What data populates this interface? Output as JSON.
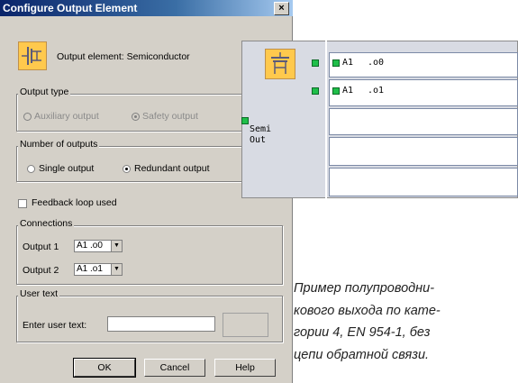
{
  "dialog": {
    "title": "Configure Output Element",
    "close_glyph": "×",
    "element_label": "Output element: Semiconductor",
    "output_type": {
      "label": "Output type",
      "options": [
        {
          "label": "Auxiliary output",
          "selected": false,
          "enabled": false
        },
        {
          "label": "Safety output",
          "selected": true,
          "enabled": false
        }
      ]
    },
    "number_of_outputs": {
      "label": "Number of outputs",
      "options": [
        {
          "label": "Single output",
          "selected": false
        },
        {
          "label": "Redundant output",
          "selected": true
        }
      ]
    },
    "feedback_loop": {
      "label": "Feedback loop used",
      "checked": false
    },
    "connections": {
      "label": "Connections",
      "output1": {
        "label": "Output 1",
        "value": "A1 .o0"
      },
      "output2": {
        "label": "Output 2",
        "value": "A1 .o1"
      }
    },
    "user_text": {
      "label": "User text",
      "field_label": "Enter user text:",
      "value": ""
    },
    "buttons": {
      "ok": "OK",
      "cancel": "Cancel",
      "help": "Help"
    }
  },
  "diagram": {
    "block_label_line1": "Semi",
    "block_label_line2": "Out",
    "outputs": [
      {
        "label": "A1",
        "value": ".o0"
      },
      {
        "label": "A1",
        "value": ".o1"
      }
    ]
  },
  "caption": {
    "lines": [
      "Пример полупроводни-",
      "кового выхода по кате-",
      "гории 4, EN 954-1, без",
      "цепи обратной связи."
    ]
  },
  "colors": {
    "accent": "#0a246a",
    "icon_fill": "#ffc94d",
    "connector": "#1fbf4a"
  }
}
